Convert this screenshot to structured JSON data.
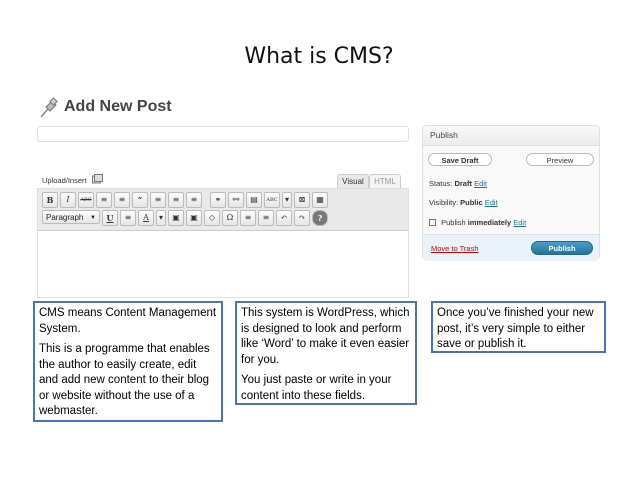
{
  "slide": {
    "title": "What is CMS?"
  },
  "wp": {
    "page_title": "Add New Post",
    "upload_insert": "Upload/Insert",
    "tabs": {
      "visual": "Visual",
      "html": "HTML"
    },
    "toolbar": {
      "row1": [
        "B",
        "I",
        "ABC",
        "≡",
        "≡",
        "“",
        "≡",
        "≡",
        "≡",
        "⚭",
        "⚯",
        "▤",
        "ABC",
        "▾",
        "⊠",
        "▦"
      ],
      "format_select": "Paragraph",
      "row2": [
        "U",
        "≡",
        "A",
        "▾",
        "▣",
        "▣",
        "◇",
        "Ω",
        "≡",
        "≡",
        "↶",
        "↷",
        "?"
      ]
    },
    "publish": {
      "title": "Publish",
      "save_draft": "Save Draft",
      "preview": "Preview",
      "status_label": "Status:",
      "status_value": "Draft",
      "visibility_label": "Visibility:",
      "visibility_value": "Public",
      "publish_label": "Publish",
      "publish_value": "immediately",
      "edit": "Edit",
      "move_to_trash": "Move to Trash",
      "publish_button": "Publish"
    }
  },
  "callouts": {
    "one": {
      "p1": "CMS means Content Management System.",
      "p2": "This is a programme that enables the author to easily create, edit and add new content to their blog or website without the use of a webmaster."
    },
    "two": {
      "p1": "This system is WordPress, which is designed to look and perform like ‘Word’ to make it even easier for you.",
      "p2": "You just paste or write in your content into these fields."
    },
    "three": {
      "p1": "Once you’ve finished your new post, it’s very simple to either save or publish it."
    }
  },
  "colors": {
    "callout_border": "#4a72c4",
    "wp_link": "#21759b",
    "trash": "#bc0b0b",
    "publish_button": "#21759b"
  }
}
